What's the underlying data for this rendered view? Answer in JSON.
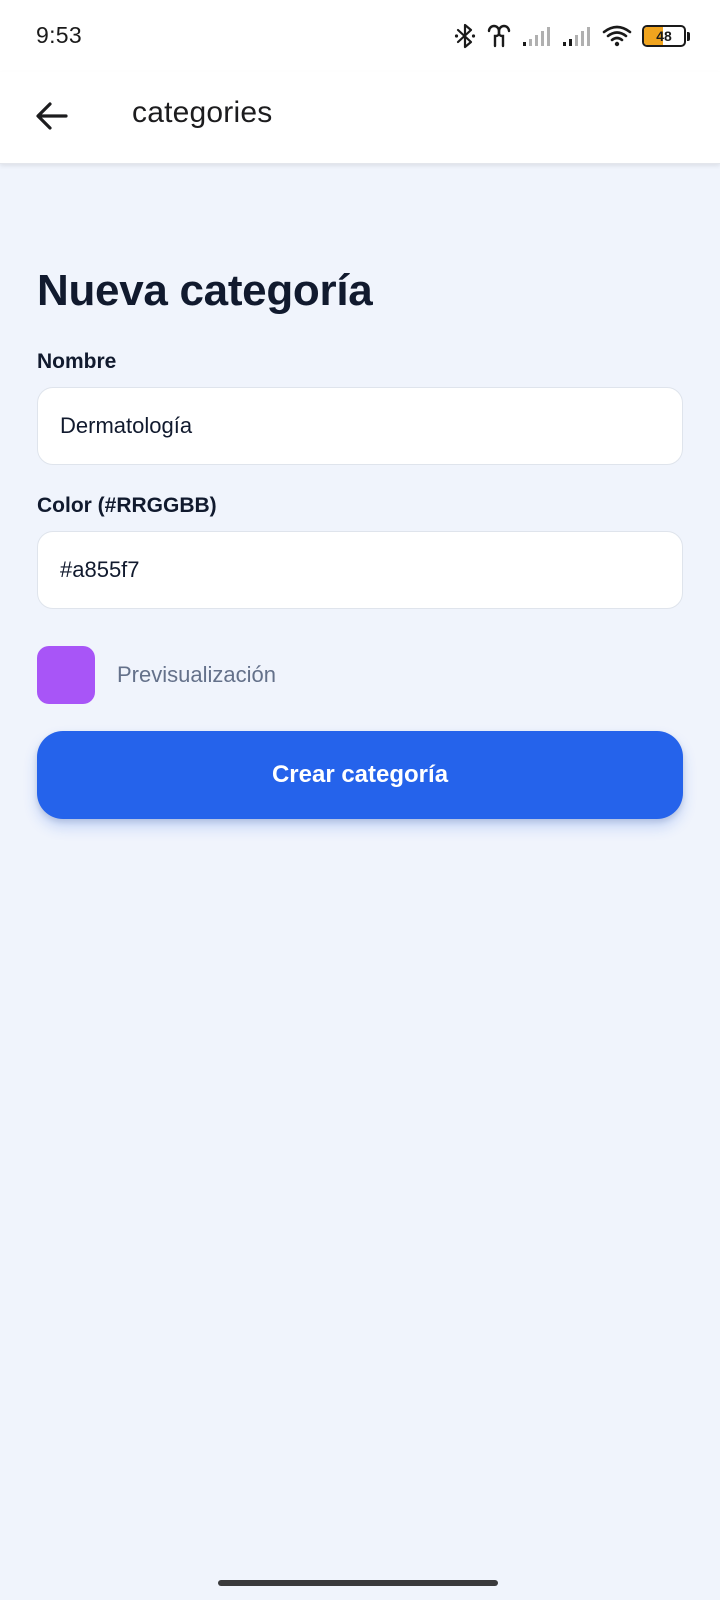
{
  "status_bar": {
    "time": "9:53",
    "battery_level": "48",
    "icons": [
      "bluetooth-icon",
      "earbuds-icon",
      "signal-icon",
      "signal-icon",
      "wifi-icon",
      "battery-icon"
    ]
  },
  "app_bar": {
    "back_icon": "arrow-left-icon",
    "title": "categories"
  },
  "form": {
    "heading": "Nueva categoría",
    "name_label": "Nombre",
    "name_value": "Dermatología",
    "color_label": "Color (#RRGGBB)",
    "color_value": "#a855f7",
    "preview_label": "Previsualización",
    "preview_color": "#a855f7",
    "submit_label": "Crear categoría"
  },
  "theme": {
    "primary": "#2563eb",
    "background": "#f0f4fc",
    "battery_fill": "#f0a41e"
  }
}
